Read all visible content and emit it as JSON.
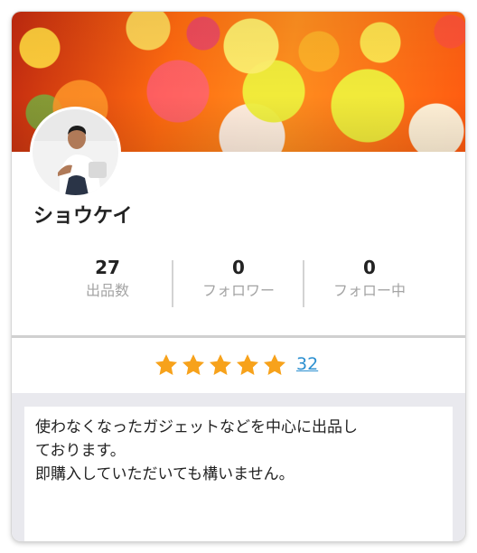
{
  "profile": {
    "name": "ショウケイ"
  },
  "stats": [
    {
      "value": "27",
      "label": "出品数"
    },
    {
      "value": "0",
      "label": "フォロワー"
    },
    {
      "value": "0",
      "label": "フォロー中"
    }
  ],
  "rating": {
    "stars": 5,
    "count": "32",
    "star_color": "#f7a21b",
    "link_color": "#2b8fd0"
  },
  "description": "使わなくなったガジェットなどを中心に出品し\nております。\n即購入していただいても構いません。",
  "icons": {
    "star": "star-icon"
  }
}
